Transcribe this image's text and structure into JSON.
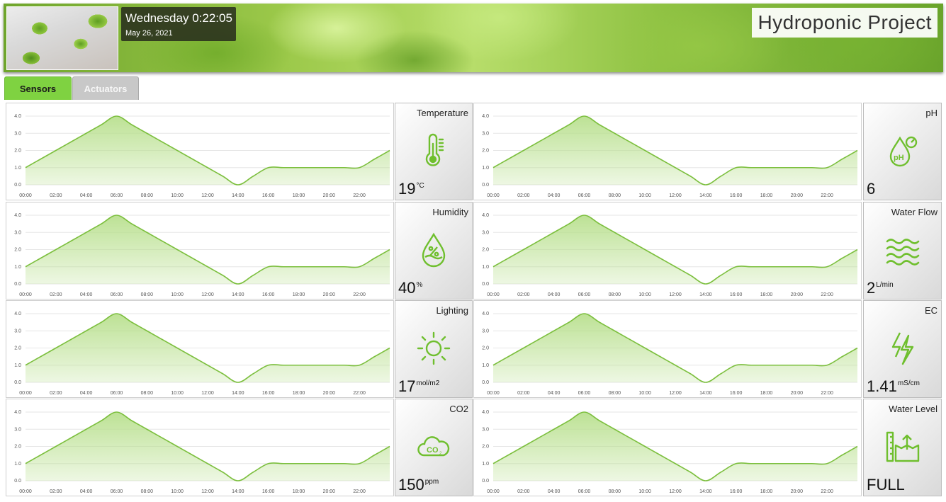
{
  "header": {
    "day_time": "Wednesday 0:22:05",
    "date": "May 26, 2021",
    "title": "Hydroponic Project"
  },
  "tabs": [
    {
      "label": "Sensors",
      "active": true
    },
    {
      "label": "Actuators",
      "active": false
    }
  ],
  "colors": {
    "accent": "#7fd241",
    "line": "#7cbf3e",
    "area": "#b9e08f",
    "icon": "#6fbf2e"
  },
  "sensors": [
    {
      "label": "Temperature",
      "value": "19",
      "unit": "°C",
      "icon": "thermometer-icon"
    },
    {
      "label": "pH",
      "value": "6",
      "unit": "",
      "icon": "ph-drop-icon"
    },
    {
      "label": "Humidity",
      "value": "40",
      "unit": "%",
      "icon": "humidity-drop-icon"
    },
    {
      "label": "Water Flow",
      "value": "2",
      "unit": "L/min",
      "icon": "water-waves-icon"
    },
    {
      "label": "Lighting",
      "value": "17",
      "unit": "mol/m2",
      "icon": "sun-icon"
    },
    {
      "label": "EC",
      "value": "1.41",
      "unit": "mS/cm",
      "icon": "lightning-icon"
    },
    {
      "label": "CO2",
      "value": "150",
      "unit": "ppm",
      "icon": "co2-cloud-icon"
    },
    {
      "label": "Water Level",
      "value": "FULL",
      "unit": "",
      "icon": "water-level-icon"
    }
  ],
  "chart_data": {
    "type": "area",
    "x": [
      "00:00",
      "01:00",
      "02:00",
      "03:00",
      "04:00",
      "05:00",
      "06:00",
      "07:00",
      "08:00",
      "09:00",
      "10:00",
      "11:00",
      "12:00",
      "13:00",
      "14:00",
      "15:00",
      "16:00",
      "17:00",
      "18:00",
      "19:00",
      "20:00",
      "21:00",
      "22:00",
      "23:00",
      "24:00"
    ],
    "values": [
      1,
      1.5,
      2,
      2.5,
      3,
      3.5,
      4,
      3.5,
      3,
      2.5,
      2,
      1.5,
      1,
      0.5,
      0,
      0.5,
      1,
      1,
      1,
      1,
      1,
      1,
      1,
      1.5,
      2
    ],
    "xticks": [
      "00:00",
      "02:00",
      "04:00",
      "06:00",
      "08:00",
      "10:00",
      "12:00",
      "14:00",
      "16:00",
      "18:00",
      "20:00",
      "22:00"
    ],
    "yticks": [
      "0.0",
      "1.0",
      "2.0",
      "3.0",
      "4.0"
    ],
    "ylim": [
      0,
      4
    ],
    "grid": true,
    "legend": "none"
  }
}
